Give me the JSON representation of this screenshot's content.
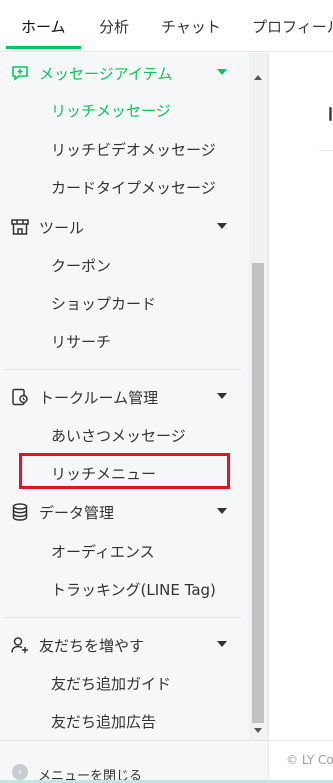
{
  "tabs": [
    {
      "label": "ホーム",
      "active": true
    },
    {
      "label": "分析",
      "active": false
    },
    {
      "label": "チャット",
      "active": false
    },
    {
      "label": "プロフィール",
      "active": false
    }
  ],
  "sidebar": {
    "groups": [
      {
        "label": "メッセージアイテム",
        "icon": "message-item-icon",
        "expanded": true,
        "items": [
          "リッチメッセージ",
          "リッチビデオメッセージ",
          "カードタイプメッセージ"
        ]
      },
      {
        "label": "ツール",
        "icon": "store-icon",
        "expanded": true,
        "items": [
          "クーポン",
          "ショップカード",
          "リサーチ"
        ]
      },
      {
        "label": "トークルーム管理",
        "icon": "talk-room-icon",
        "expanded": true,
        "items": [
          "あいさつメッセージ",
          "リッチメニュー"
        ]
      },
      {
        "label": "データ管理",
        "icon": "database-icon",
        "expanded": true,
        "items": [
          "オーディエンス",
          "トラッキング(LINE Tag)"
        ]
      },
      {
        "label": "友だちを増やす",
        "icon": "add-friend-icon",
        "expanded": true,
        "items": [
          "友だち追加ガイド",
          "友だち追加広告"
        ]
      }
    ],
    "active_item": "リッチメッセージ",
    "highlighted_item": "リッチメニュー",
    "close_menu_label": "メニューを閉じる"
  },
  "main": {
    "title": "リ",
    "copyright": "© LY Co"
  },
  "colors": {
    "accent": "#06c755",
    "highlight": "#e2141f",
    "sidebar_bg": "#f6f7f8"
  }
}
